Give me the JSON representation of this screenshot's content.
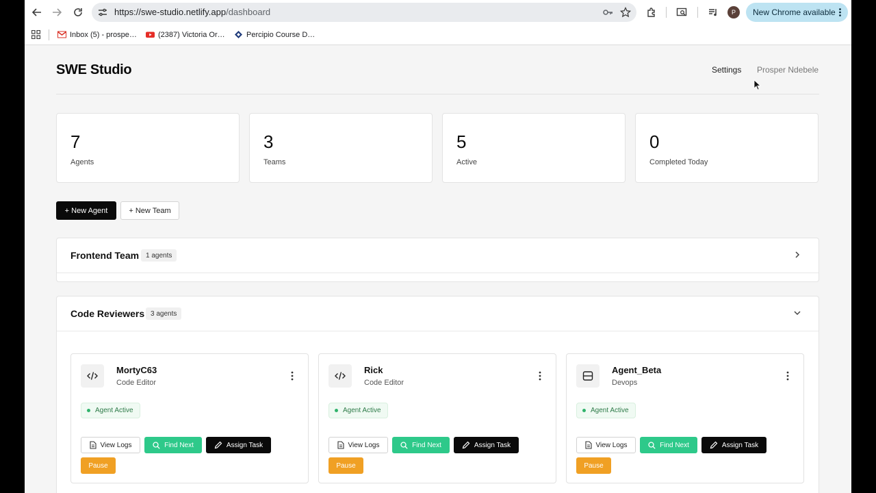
{
  "browser": {
    "url_host": "https://swe-studio.netlify.app",
    "url_path": "/dashboard",
    "profile_initial": "P",
    "update_label": "New Chrome available",
    "bookmarks": [
      {
        "label": "Inbox (5) - prospe…",
        "icon": "gmail-icon"
      },
      {
        "label": "(2387) Victoria Or…",
        "icon": "youtube-icon"
      },
      {
        "label": "Percipio Course D…",
        "icon": "percipio-icon"
      }
    ]
  },
  "app": {
    "title": "SWE Studio",
    "nav": {
      "settings": "Settings",
      "user": "Prosper Ndebele"
    }
  },
  "stats": [
    {
      "value": "7",
      "label": "Agents"
    },
    {
      "value": "3",
      "label": "Teams"
    },
    {
      "value": "5",
      "label": "Active"
    },
    {
      "value": "0",
      "label": "Completed Today"
    }
  ],
  "actions": {
    "new_agent": "+ New Agent",
    "new_team": "+ New Team"
  },
  "teams": [
    {
      "name": "Frontend Team",
      "count": "1 agents",
      "expanded": false
    },
    {
      "name": "Code Reviewers",
      "count": "3 agents",
      "expanded": true
    }
  ],
  "agents": [
    {
      "name": "MortyC63",
      "role": "Code Editor",
      "icon": "code-icon",
      "status": "Agent Active"
    },
    {
      "name": "Rick",
      "role": "Code Editor",
      "icon": "code-icon",
      "status": "Agent Active"
    },
    {
      "name": "Agent_Beta",
      "role": "Devops",
      "icon": "server-icon",
      "status": "Agent Active"
    }
  ],
  "agent_actions": {
    "view_logs": "View Logs",
    "find_next": "Find Next",
    "assign_task": "Assign Task",
    "pause": "Pause"
  },
  "colors": {
    "accent_green": "#2ec98a",
    "pause_orange": "#f0a024",
    "primary": "#0a0a0a",
    "chrome_update": "#bde3f2"
  }
}
